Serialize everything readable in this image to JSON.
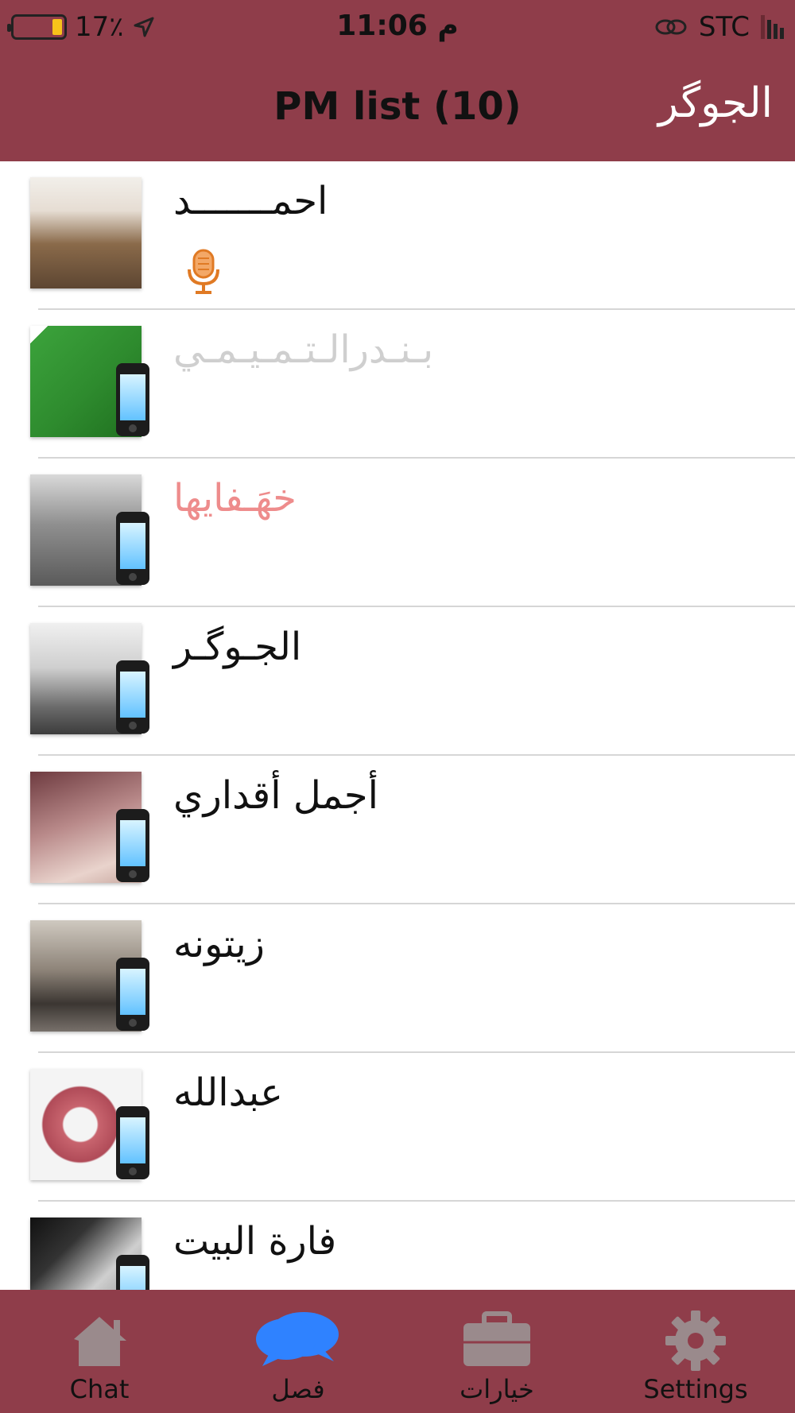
{
  "status": {
    "battery": "17٪",
    "time": "11:06 م",
    "carrier": "STC"
  },
  "header": {
    "title": "PM list (10)",
    "right_label": "الجوگر"
  },
  "conversations": [
    {
      "name": "احمـــــــد",
      "style": "normal",
      "status_icon": "microphone-icon"
    },
    {
      "name": "بـنـدرالـتـمـيـمـي",
      "style": "grey",
      "status_icon": "mobile-phone-icon"
    },
    {
      "name": "خهَـفايها",
      "style": "pink",
      "status_icon": "mobile-phone-icon"
    },
    {
      "name": "الجـوگـر",
      "style": "normal",
      "status_icon": "mobile-phone-icon"
    },
    {
      "name": "أجمل أقداري",
      "style": "normal",
      "status_icon": "mobile-phone-icon"
    },
    {
      "name": "زيتونه",
      "style": "normal",
      "status_icon": "mobile-phone-icon"
    },
    {
      "name": "عبدالله",
      "style": "normal",
      "status_icon": "mobile-phone-icon"
    },
    {
      "name": "فارة البيت",
      "style": "normal",
      "status_icon": "mobile-phone-icon"
    }
  ],
  "tabs": [
    {
      "label": "Chat",
      "icon": "house-icon"
    },
    {
      "label": "فصل",
      "icon": "chat-bubbles-icon"
    },
    {
      "label": "خيارات",
      "icon": "toolbox-icon"
    },
    {
      "label": "Settings",
      "icon": "gear-icon"
    }
  ],
  "colors": {
    "bar": "#8f3d4a",
    "active_tab": "#2f82ff",
    "inactive_tab": "#9a8a8c"
  }
}
